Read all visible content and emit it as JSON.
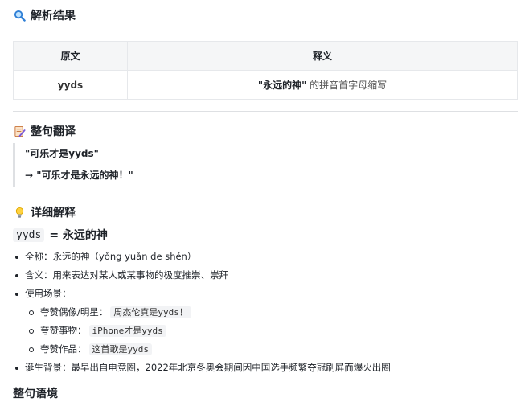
{
  "result": {
    "icon": "magnifier-icon",
    "title": "解析结果",
    "table": {
      "headers": [
        "原文",
        "释义"
      ],
      "rows": [
        {
          "word": "yyds",
          "meaning_strong": "\"永远的神\"",
          "meaning_rest": "的拼音首字母缩写"
        }
      ]
    }
  },
  "translation": {
    "icon": "memo-icon",
    "title": "整句翻译",
    "original": "\"可乐才是yyds\"",
    "translated": "→ \"可乐才是永远的神！\""
  },
  "detail": {
    "icon": "lightbulb-icon",
    "title": "详细解释",
    "term": "yyds",
    "equals": "= 永远的神",
    "items": {
      "fullname": "全称：永远的神（yǒng yuǎn de shén）",
      "meaning": "含义：用来表达对某人或某事物的极度推崇、崇拜",
      "scenarios_label": "使用场景：",
      "scenarios": [
        {
          "label": "夸赞偶像/明星：",
          "example": "周杰伦真是yyds！"
        },
        {
          "label": "夸赞事物：",
          "example": "iPhone才是yyds"
        },
        {
          "label": "夸赞作品：",
          "example": "这首歌是yyds"
        }
      ],
      "background": "诞生背景：最早出自电竞圈，2022年北京冬奥会期间因中国选手频繁夺冠刷屏而爆火出圈"
    }
  },
  "context": {
    "title": "整句语境"
  },
  "colors": {
    "text": "#1f2329",
    "table_header_bg": "#f5f6f7",
    "border": "#e6e8eb",
    "code_bg": "#f2f3f5"
  }
}
